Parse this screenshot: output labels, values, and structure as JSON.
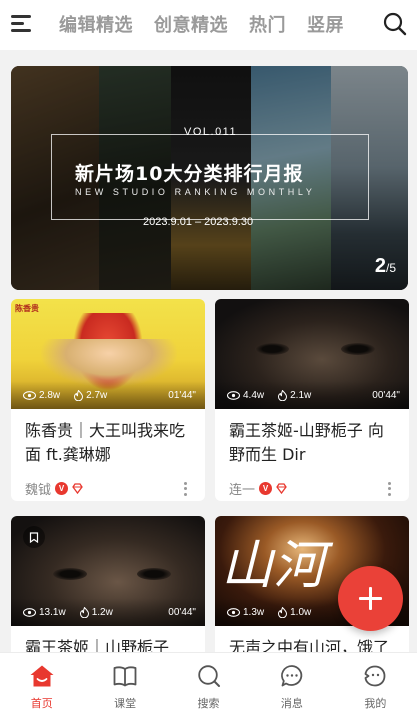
{
  "topnav": {
    "tabs": [
      "编辑精选",
      "创意精选",
      "热门",
      "竖屏"
    ],
    "menu_icon": "hamburger-menu-icon",
    "search_icon": "search-icon"
  },
  "banner": {
    "vol": "VOL.011",
    "title": "新片场10大分类排行月报",
    "subtitle": "NEW STUDIO RANKING MONTHLY",
    "date_range": "2023.9.01 – 2023.9.30",
    "page_current": "2",
    "page_separator": "/",
    "page_total": "5"
  },
  "cards": [
    {
      "title": "陈香贵｜大王叫我来吃面 ft.龚琳娜",
      "views": "2.8w",
      "likes": "2.7w",
      "duration": "01'44\"",
      "author": "魏钺",
      "thumb_label": "陈香贵"
    },
    {
      "title": "霸王茶姬-山野栀子 向野而生 Dir",
      "views": "4.4w",
      "likes": "2.1w",
      "duration": "00'44\"",
      "author": "连一"
    },
    {
      "title": "霸王茶姬｜山野栀子",
      "views": "13.1w",
      "likes": "1.2w",
      "duration": "00'44\""
    },
    {
      "title": "无声之中有山河，饿了",
      "views": "1.3w",
      "likes": "1.0w",
      "thumb_text": "山河"
    }
  ],
  "bottomnav": {
    "items": [
      {
        "label": "首页",
        "icon": "home-icon",
        "active": true
      },
      {
        "label": "课堂",
        "icon": "book-icon",
        "active": false
      },
      {
        "label": "搜索",
        "icon": "search-icon",
        "active": false
      },
      {
        "label": "消息",
        "icon": "message-icon",
        "active": false
      },
      {
        "label": "我的",
        "icon": "profile-icon",
        "active": false
      }
    ]
  },
  "colors": {
    "accent": "#e8382f",
    "tab_inactive": "#9a9a9a",
    "background": "#f2f2f2"
  }
}
